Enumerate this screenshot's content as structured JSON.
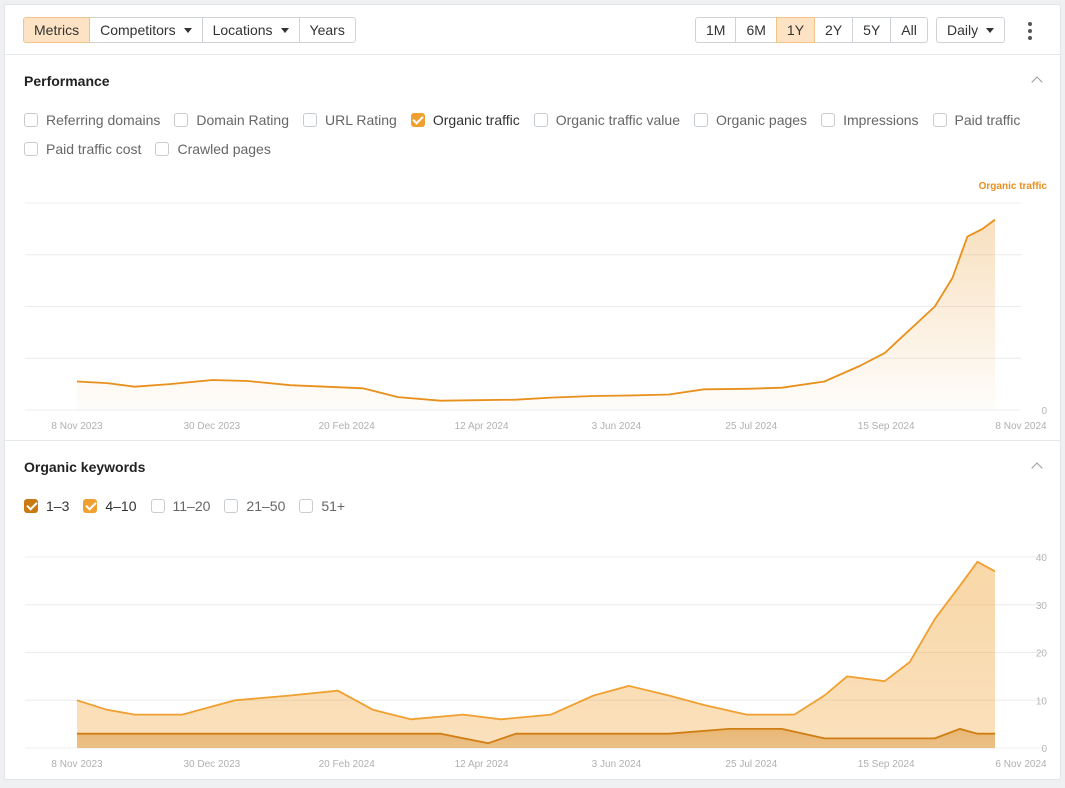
{
  "toolbar": {
    "tabs": [
      {
        "label": "Metrics",
        "active": true,
        "dropdown": false
      },
      {
        "label": "Competitors",
        "active": false,
        "dropdown": true
      },
      {
        "label": "Locations",
        "active": false,
        "dropdown": true
      },
      {
        "label": "Years",
        "active": false,
        "dropdown": false
      }
    ],
    "ranges": [
      {
        "label": "1M",
        "active": false
      },
      {
        "label": "6M",
        "active": false
      },
      {
        "label": "1Y",
        "active": true
      },
      {
        "label": "2Y",
        "active": false
      },
      {
        "label": "5Y",
        "active": false
      },
      {
        "label": "All",
        "active": false
      }
    ],
    "interval": "Daily",
    "more_icon": "kebab-menu-icon"
  },
  "performance": {
    "title": "Performance",
    "collapse_icon": "chevron-up-icon",
    "metrics": [
      {
        "label": "Referring domains",
        "checked": false
      },
      {
        "label": "Domain Rating",
        "checked": false
      },
      {
        "label": "URL Rating",
        "checked": false
      },
      {
        "label": "Organic traffic",
        "checked": true
      },
      {
        "label": "Organic traffic value",
        "checked": false
      },
      {
        "label": "Organic pages",
        "checked": false
      },
      {
        "label": "Impressions",
        "checked": false
      },
      {
        "label": "Paid traffic",
        "checked": false
      },
      {
        "label": "Paid traffic cost",
        "checked": false
      },
      {
        "label": "Crawled pages",
        "checked": false
      }
    ]
  },
  "keywords": {
    "title": "Organic keywords",
    "collapse_icon": "chevron-up-icon",
    "positions": [
      {
        "label": "1–3",
        "checked": true,
        "color": "#c97a12"
      },
      {
        "label": "4–10",
        "checked": true,
        "color": "#f0a030"
      },
      {
        "label": "11–20",
        "checked": false
      },
      {
        "label": "21–50",
        "checked": false
      },
      {
        "label": "51+",
        "checked": false
      }
    ]
  },
  "colors": {
    "accent": "#f0a030",
    "traffic_line": "#e8901c",
    "kw_top3": "#d07e14",
    "kw_4_10": "#f0a030",
    "active_bg": "#fde3c3"
  },
  "chart_data": [
    {
      "type": "area",
      "title": "",
      "legend": "Organic traffic",
      "x_ticks": [
        "8 Nov 2023",
        "30 Dec 2023",
        "20 Feb 2024",
        "12 Apr 2024",
        "3 Jun 2024",
        "25 Jul 2024",
        "15 Sep 2024",
        "8 Nov 2024"
      ],
      "y_ticks": [
        "0",
        "",
        "",
        "",
        ""
      ],
      "ylim": [
        0,
        400
      ],
      "grid": true,
      "series": [
        {
          "name": "Organic traffic",
          "x": [
            "2023-11-08",
            "2023-11-20",
            "2023-12-01",
            "2023-12-15",
            "2024-01-01",
            "2024-01-15",
            "2024-02-01",
            "2024-02-15",
            "2024-03-01",
            "2024-03-15",
            "2024-04-01",
            "2024-04-15",
            "2024-05-01",
            "2024-05-15",
            "2024-06-01",
            "2024-06-15",
            "2024-07-01",
            "2024-07-15",
            "2024-08-01",
            "2024-08-15",
            "2024-09-01",
            "2024-09-15",
            "2024-09-25",
            "2024-10-05",
            "2024-10-15",
            "2024-10-22",
            "2024-10-28",
            "2024-11-03",
            "2024-11-08"
          ],
          "values": [
            55,
            52,
            45,
            50,
            58,
            56,
            48,
            45,
            42,
            25,
            18,
            19,
            20,
            24,
            27,
            28,
            30,
            40,
            41,
            43,
            55,
            85,
            110,
            155,
            200,
            255,
            335,
            350,
            368
          ]
        }
      ]
    },
    {
      "type": "area",
      "title": "",
      "x_ticks": [
        "8 Nov 2023",
        "30 Dec 2023",
        "20 Feb 2024",
        "12 Apr 2024",
        "3 Jun 2024",
        "25 Jul 2024",
        "15 Sep 2024",
        "6 Nov 2024"
      ],
      "y_ticks": [
        "0",
        "10",
        "20",
        "30",
        "40"
      ],
      "ylim": [
        0,
        40
      ],
      "grid": true,
      "series": [
        {
          "name": "1–3",
          "x": [
            "2023-11-08",
            "2023-12-01",
            "2024-01-01",
            "2024-02-01",
            "2024-03-01",
            "2024-04-01",
            "2024-04-20",
            "2024-05-01",
            "2024-06-01",
            "2024-07-01",
            "2024-07-25",
            "2024-08-15",
            "2024-09-01",
            "2024-09-15",
            "2024-10-01",
            "2024-10-15",
            "2024-10-25",
            "2024-11-01",
            "2024-11-08"
          ],
          "values": [
            3,
            3,
            3,
            3,
            3,
            3,
            1,
            3,
            3,
            3,
            4,
            4,
            2,
            2,
            2,
            2,
            4,
            3,
            3
          ]
        },
        {
          "name": "4–10",
          "x": [
            "2023-11-08",
            "2023-11-20",
            "2023-12-01",
            "2023-12-20",
            "2024-01-10",
            "2024-02-01",
            "2024-02-20",
            "2024-03-05",
            "2024-03-20",
            "2024-04-10",
            "2024-04-25",
            "2024-05-15",
            "2024-06-01",
            "2024-06-15",
            "2024-07-01",
            "2024-07-15",
            "2024-08-01",
            "2024-08-20",
            "2024-09-01",
            "2024-09-10",
            "2024-09-25",
            "2024-10-05",
            "2024-10-15",
            "2024-10-25",
            "2024-11-01",
            "2024-11-08"
          ],
          "values": [
            10,
            8,
            7,
            7,
            10,
            11,
            12,
            8,
            6,
            7,
            6,
            7,
            11,
            13,
            11,
            9,
            7,
            7,
            11,
            15,
            14,
            18,
            27,
            34,
            39,
            37
          ]
        }
      ]
    }
  ]
}
